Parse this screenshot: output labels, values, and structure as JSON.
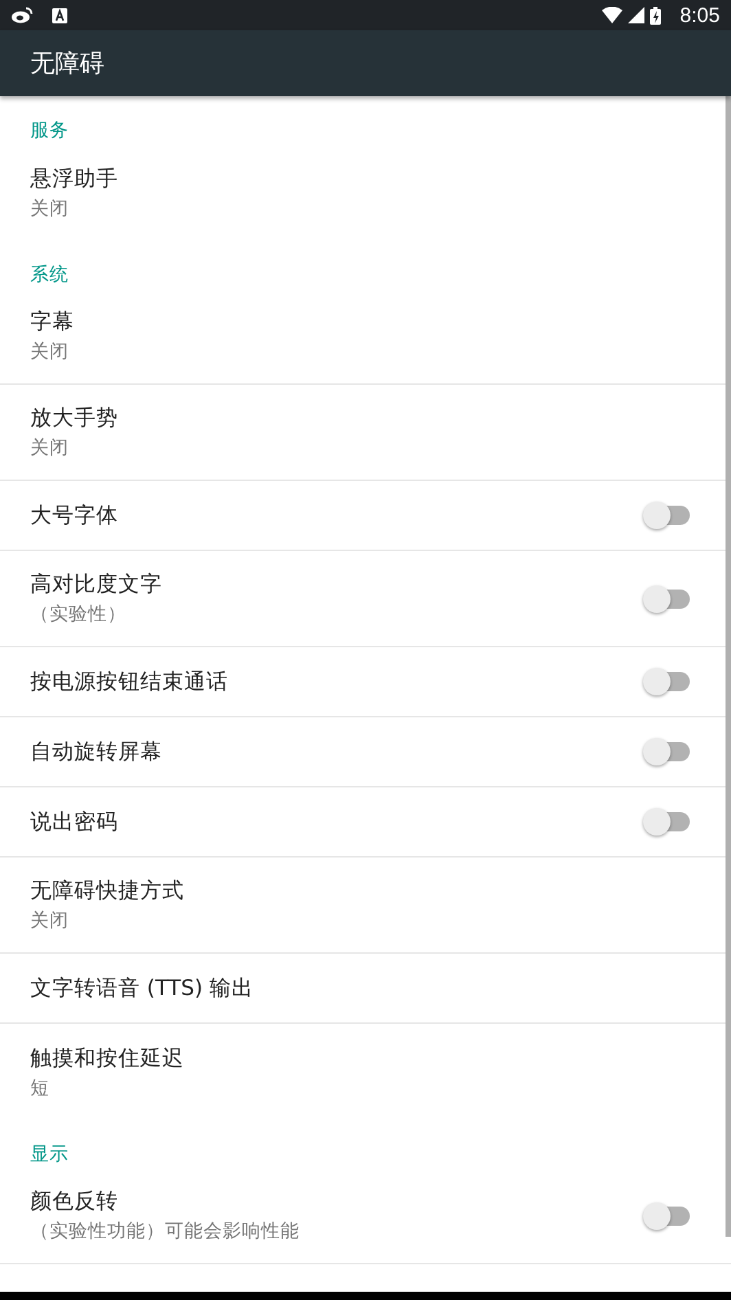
{
  "status_bar": {
    "time": "8:05"
  },
  "toolbar": {
    "title": "无障碍"
  },
  "sections": [
    {
      "header": "服务",
      "items": [
        {
          "kind": "text",
          "title": "悬浮助手",
          "subtitle": "关闭"
        }
      ]
    },
    {
      "header": "系统",
      "items": [
        {
          "kind": "text",
          "title": "字幕",
          "subtitle": "关闭"
        },
        {
          "kind": "text",
          "title": "放大手势",
          "subtitle": "关闭"
        },
        {
          "kind": "switch",
          "title": "大号字体",
          "on": false
        },
        {
          "kind": "switch",
          "title": "高对比度文字",
          "subtitle": "（实验性）",
          "on": false
        },
        {
          "kind": "switch",
          "title": "按电源按钮结束通话",
          "on": false
        },
        {
          "kind": "switch",
          "title": "自动旋转屏幕",
          "on": false
        },
        {
          "kind": "switch",
          "title": "说出密码",
          "on": false
        },
        {
          "kind": "text",
          "title": "无障碍快捷方式",
          "subtitle": "关闭"
        },
        {
          "kind": "text",
          "title": "文字转语音 (TTS) 输出"
        },
        {
          "kind": "text",
          "title": "触摸和按住延迟",
          "subtitle": "短"
        }
      ]
    },
    {
      "header": "显示",
      "items": [
        {
          "kind": "switch",
          "title": "颜色反转",
          "subtitle": "（实验性功能）可能会影响性能",
          "on": false
        }
      ]
    }
  ]
}
